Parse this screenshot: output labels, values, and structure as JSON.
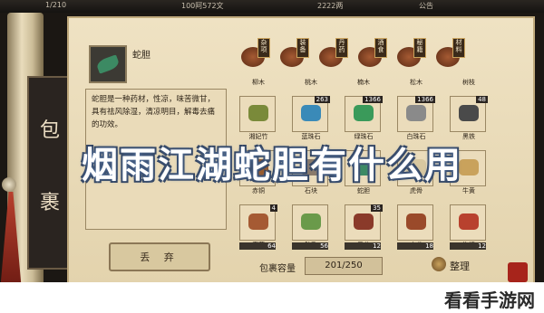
{
  "topbar": {
    "left_text": "1/210",
    "center_text": "100阿572文",
    "right_text": "2222两",
    "notice": "公告"
  },
  "side_band": {
    "char_top": "包",
    "char_bottom": "裹"
  },
  "selected_item": {
    "name": "蛇胆",
    "description": "蛇胆是一种药材，性凉，味苦微甘，具有祛风除湿，清凉明目，解毒去痛的功效。"
  },
  "buttons": {
    "discard": "丢 弃",
    "sort": "整理"
  },
  "categories": [
    {
      "label": "杂项"
    },
    {
      "label": "装备"
    },
    {
      "label": "丹药"
    },
    {
      "label": "酒食"
    },
    {
      "label": "秘籍"
    },
    {
      "label": "材料"
    }
  ],
  "items_row0": [
    {
      "name": "柳木"
    },
    {
      "name": "桃木"
    },
    {
      "name": "楠木"
    },
    {
      "name": "松木"
    },
    {
      "name": "树枝"
    }
  ],
  "items": [
    {
      "name": "湘妃竹",
      "count": "",
      "color": "#7a8a3a"
    },
    {
      "name": "蓝珠石",
      "count": "263",
      "color": "#3a8ab8"
    },
    {
      "name": "绿珠石",
      "count": "1366",
      "color": "#3a9a5a"
    },
    {
      "name": "白珠石",
      "count": "1366",
      "color": "#8a8a8a"
    },
    {
      "name": "黑铁",
      "count": "48",
      "color": "#4a4a4a"
    },
    {
      "name": "赤铜",
      "count": "",
      "color": "#9a5a2a"
    },
    {
      "name": "石块",
      "count": "",
      "color": "#8a7a6a"
    },
    {
      "name": "蛇胆",
      "count": "",
      "color": "#3c8a63"
    },
    {
      "name": "虎骨",
      "count": "",
      "color": "#d8c8a0"
    },
    {
      "name": "牛黄",
      "count": "",
      "color": "#c9a25c"
    },
    {
      "name": "鹿茸",
      "count": "4",
      "foot": "64",
      "color": "#a55a33"
    },
    {
      "name": "钟乳",
      "count": "",
      "foot": "56",
      "color": "#6a9a4a"
    },
    {
      "name": "灵芝",
      "count": "35",
      "foot": "12",
      "color": "#8a3a2a"
    },
    {
      "name": "人参",
      "count": "",
      "foot": "18",
      "color": "#9a4a2a"
    },
    {
      "name": "枸杞",
      "count": "",
      "foot": "12",
      "color": "#b8412e"
    }
  ],
  "capacity": {
    "label": "包裹容量",
    "value": "201/250"
  },
  "headline": "烟雨江湖蛇胆有什么用",
  "watermark": "看看手游网"
}
